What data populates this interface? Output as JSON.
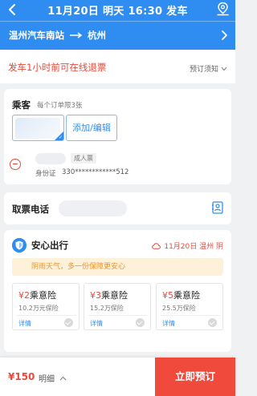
{
  "header": {
    "title": "11月20日 明天 16:30 发车",
    "origin": "温州汽车南站",
    "destination": "杭州"
  },
  "refund": {
    "text": "发车1小时前可在线退票",
    "notice_label": "预订须知"
  },
  "passenger": {
    "title": "乘客",
    "subtitle": "每个订单限3张",
    "add_label": "添加/编辑",
    "ticket_type": "成人票",
    "id_label": "身份证",
    "id_value": "330************512"
  },
  "contact": {
    "title": "取票电话"
  },
  "safe_trip": {
    "title": "安心出行",
    "weather": "11月20日 温州 阴",
    "banner": "阴雨天气，多一份保障更安心",
    "options": [
      {
        "price": "¥2",
        "name": "乘意险",
        "coverage": "10.2万元保险",
        "detail": "详情"
      },
      {
        "price": "¥3",
        "name": "乘意险",
        "coverage": "15.2万保险",
        "detail": "详情"
      },
      {
        "price": "¥5",
        "name": "乘意险",
        "coverage": "25.5万保险",
        "detail": "详情"
      }
    ]
  },
  "bottom_bar": {
    "price": "¥150",
    "detail_label": "明细",
    "submit_label": "立即预订"
  },
  "colors": {
    "primary": "#2f8df2",
    "danger": "#e64a3b",
    "submit": "#f04a3d",
    "banner_bg": "#fdf1d9",
    "banner_text": "#e9962d"
  },
  "icons": [
    "back-icon",
    "location-icon",
    "arrow-right-icon",
    "chevron-right-icon",
    "chevron-down-icon",
    "minus-circle-icon",
    "contact-book-icon",
    "shield-icon",
    "cloud-icon",
    "check-icon",
    "chevron-up-icon"
  ]
}
